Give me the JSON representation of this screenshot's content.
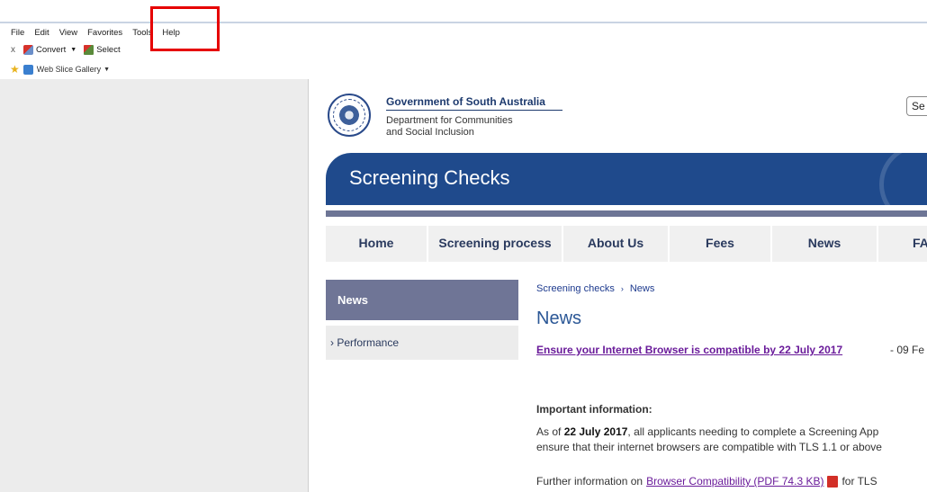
{
  "browser": {
    "menu": [
      "File",
      "Edit",
      "View",
      "Favorites",
      "Tools",
      "Help"
    ],
    "commandbar": {
      "close": "x",
      "convert": "Convert",
      "select": "Select"
    },
    "favorites": {
      "web_slice_gallery": "Web Slice Gallery"
    }
  },
  "header": {
    "gov_name": "Government of South Australia",
    "dept_line1": "Department for Communities",
    "dept_line2": "and Social Inclusion",
    "search_text": "Se"
  },
  "banner": {
    "title": "Screening Checks"
  },
  "nav": {
    "items": [
      "Home",
      "Screening process",
      "About Us",
      "Fees",
      "News",
      "FA"
    ]
  },
  "sidenav": {
    "active": "News",
    "items": [
      "› Performance"
    ]
  },
  "content": {
    "breadcrumb": [
      "Screening checks",
      "News"
    ],
    "breadcrumb_sep": "›",
    "heading": "News",
    "article_link": "Ensure your Internet Browser is compatible by 22 July 2017",
    "article_date": "- 09 Fe",
    "important_label": "Important information:",
    "para_line1_pre": "As of ",
    "para_line1_bold": "22 July 2017",
    "para_line1_post": ", all applicants needing to complete a Screening App",
    "para_line2": "ensure that their internet browsers are compatible with TLS 1.1 or above",
    "further_pre": "Further information on",
    "further_link": "Browser Compatibility (PDF 74.3 KB)",
    "further_post": "for TLS"
  },
  "colors": {
    "banner": "#1f4a8c",
    "sidenav_active": "#6f7596",
    "highlight": "#e60000"
  }
}
